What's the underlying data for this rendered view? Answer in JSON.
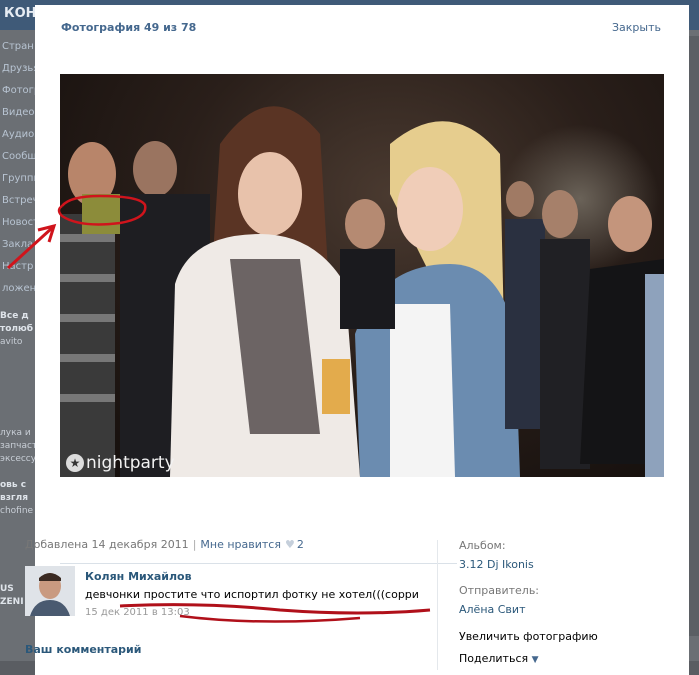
{
  "background": {
    "logo_text": "КОН",
    "left_menu": [
      "Стран",
      "Друзья",
      "Фотогр",
      "Видеоз",
      "Аудиоз",
      "Сообще",
      "Группы",
      "Встречи",
      "Новост",
      "Закла",
      "Настр",
      "ложени"
    ],
    "ad_title": "Все д",
    "ad_subtitle": "толюб",
    "ad_source": "avito",
    "ad_text": "лука и запчаст эксессу",
    "ad2_title": "овь с",
    "ad2_subtitle": "взгля",
    "ad2_source": "chofine",
    "ad3_title": "US ZENI"
  },
  "viewer": {
    "counter": "Фотография 49 из 78",
    "close_label": "Закрыть",
    "photo_watermark": "nightparty",
    "meta": {
      "added": "Добавлена 14 декабря 2011",
      "like_label": "Мне нравится",
      "like_count": "2"
    },
    "comment": {
      "author": "Колян Михайлов",
      "text": "девчонки простите что испортил фотку не хотел(((сорри",
      "date": "15 дек 2011 в 13:03"
    },
    "your_comment_label": "Ваш комментарий",
    "sidebar": {
      "album_label": "Альбом:",
      "album_value": "3.12 Dj Ikonis",
      "sender_label": "Отправитель:",
      "sender_value": "Алёна Свит",
      "enlarge_label": "Увеличить фотографию",
      "share_label": "Поделиться"
    }
  },
  "colors": {
    "link": "#45688e",
    "annotation": "#d0141c"
  }
}
